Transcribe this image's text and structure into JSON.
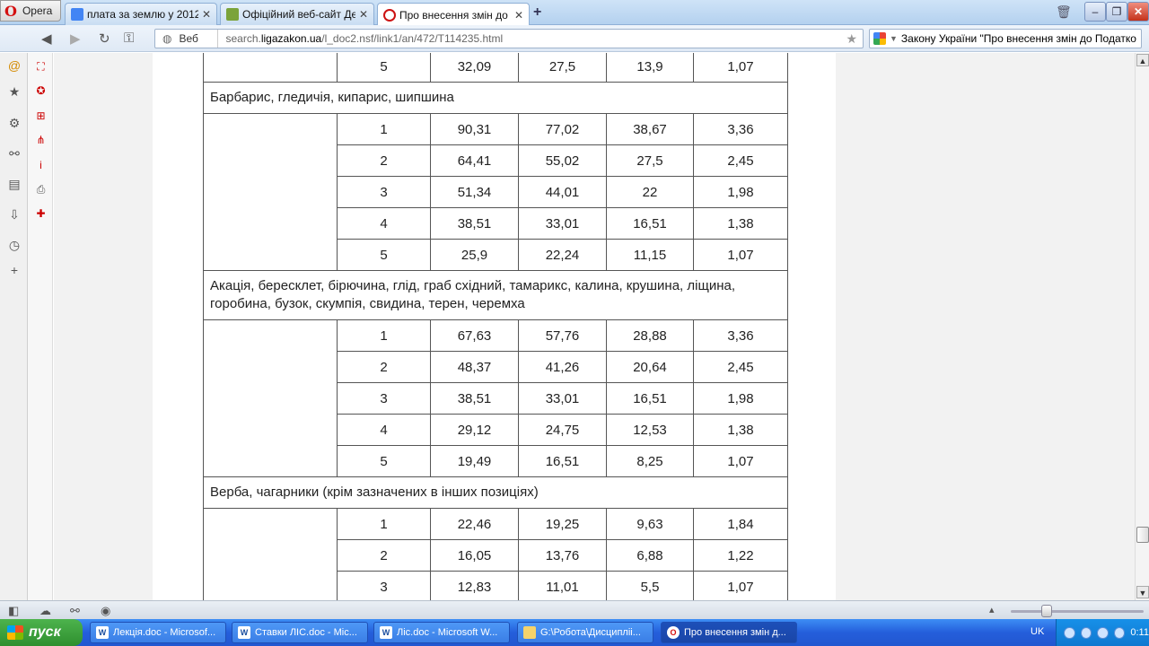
{
  "browser": {
    "menu_label": "Opera",
    "tabs": [
      {
        "title": "плата за землю у 2012 ...",
        "active": false,
        "color": "#4285f4"
      },
      {
        "title": "Офіційний веб-сайт Де...",
        "active": false,
        "color": "#7ba33a"
      },
      {
        "title": "Про внесення змін до П...",
        "active": true,
        "color": "#cc1111"
      }
    ],
    "address": {
      "scheme_label": "Веб",
      "prefix": "search.",
      "domain": "ligazakon.ua",
      "path": "/l_doc2.nsf/link1/an/472/T114235.html"
    },
    "search_text": "Закону України \"Про внесення змін до Податко"
  },
  "table": {
    "top_rows": [
      {
        "num": "5",
        "v1": "32,09",
        "v2": "27,5",
        "v3": "13,9",
        "v4": "1,07"
      }
    ],
    "groups": [
      {
        "heading": "Барбарис, гледичія, кипарис, шипшина",
        "rows": [
          {
            "num": "1",
            "v1": "90,31",
            "v2": "77,02",
            "v3": "38,67",
            "v4": "3,36"
          },
          {
            "num": "2",
            "v1": "64,41",
            "v2": "55,02",
            "v3": "27,5",
            "v4": "2,45"
          },
          {
            "num": "3",
            "v1": "51,34",
            "v2": "44,01",
            "v3": "22",
            "v4": "1,98"
          },
          {
            "num": "4",
            "v1": "38,51",
            "v2": "33,01",
            "v3": "16,51",
            "v4": "1,38"
          },
          {
            "num": "5",
            "v1": "25,9",
            "v2": "22,24",
            "v3": "11,15",
            "v4": "1,07"
          }
        ]
      },
      {
        "heading": "Акація, бересклет, бірючина, глід, граб східний, тамарикс, калина, крушина, ліщина, горобина, бузок, скумпія, свидина, терен, черемха",
        "rows": [
          {
            "num": "1",
            "v1": "67,63",
            "v2": "57,76",
            "v3": "28,88",
            "v4": "3,36"
          },
          {
            "num": "2",
            "v1": "48,37",
            "v2": "41,26",
            "v3": "20,64",
            "v4": "2,45"
          },
          {
            "num": "3",
            "v1": "38,51",
            "v2": "33,01",
            "v3": "16,51",
            "v4": "1,98"
          },
          {
            "num": "4",
            "v1": "29,12",
            "v2": "24,75",
            "v3": "12,53",
            "v4": "1,38"
          },
          {
            "num": "5",
            "v1": "19,49",
            "v2": "16,51",
            "v3": "8,25",
            "v4": "1,07"
          }
        ]
      },
      {
        "heading": "Верба, чагарники (крім зазначених в інших позиціях)",
        "rows": [
          {
            "num": "1",
            "v1": "22,46",
            "v2": "19,25",
            "v3": "9,63",
            "v4": "1,84"
          },
          {
            "num": "2",
            "v1": "16,05",
            "v2": "13,76",
            "v3": "6,88",
            "v4": "1,22"
          },
          {
            "num": "3",
            "v1": "12,83",
            "v2": "11,01",
            "v3": "5,5",
            "v4": "1,07"
          }
        ]
      }
    ]
  },
  "taskbar": {
    "start_label": "пуск",
    "tasks": [
      {
        "label": "Лекція.doc - Microsof...",
        "icon": "word-icon",
        "active": false
      },
      {
        "label": "Ставки ЛІС.doc - Mic...",
        "icon": "word-icon",
        "active": false
      },
      {
        "label": "Ліс.doc - Microsoft W...",
        "icon": "word-icon",
        "active": false
      },
      {
        "label": "G:\\Робота\\Дисципліі...",
        "icon": "folder-icon",
        "active": false
      },
      {
        "label": "Про внесення змін д...",
        "icon": "opera-icon",
        "active": true
      }
    ],
    "lang": "UK",
    "clock": "0:11"
  }
}
